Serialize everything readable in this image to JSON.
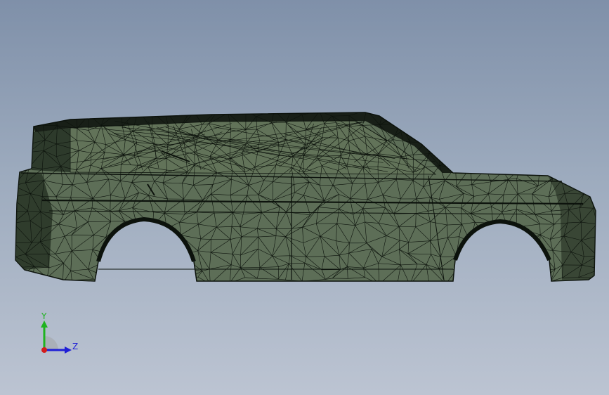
{
  "model": {
    "type": "wireframe-vehicle",
    "fill_color": "#5d6e57",
    "edge_color": "#0c120c"
  },
  "triad": {
    "y_label": "Y",
    "z_label": "Z",
    "y_color": "#1fb31f",
    "z_color": "#1f1fd6",
    "x_color": "#d21d1d"
  },
  "background": {
    "top": "#7f90a9",
    "bottom": "#bcc4d2"
  }
}
